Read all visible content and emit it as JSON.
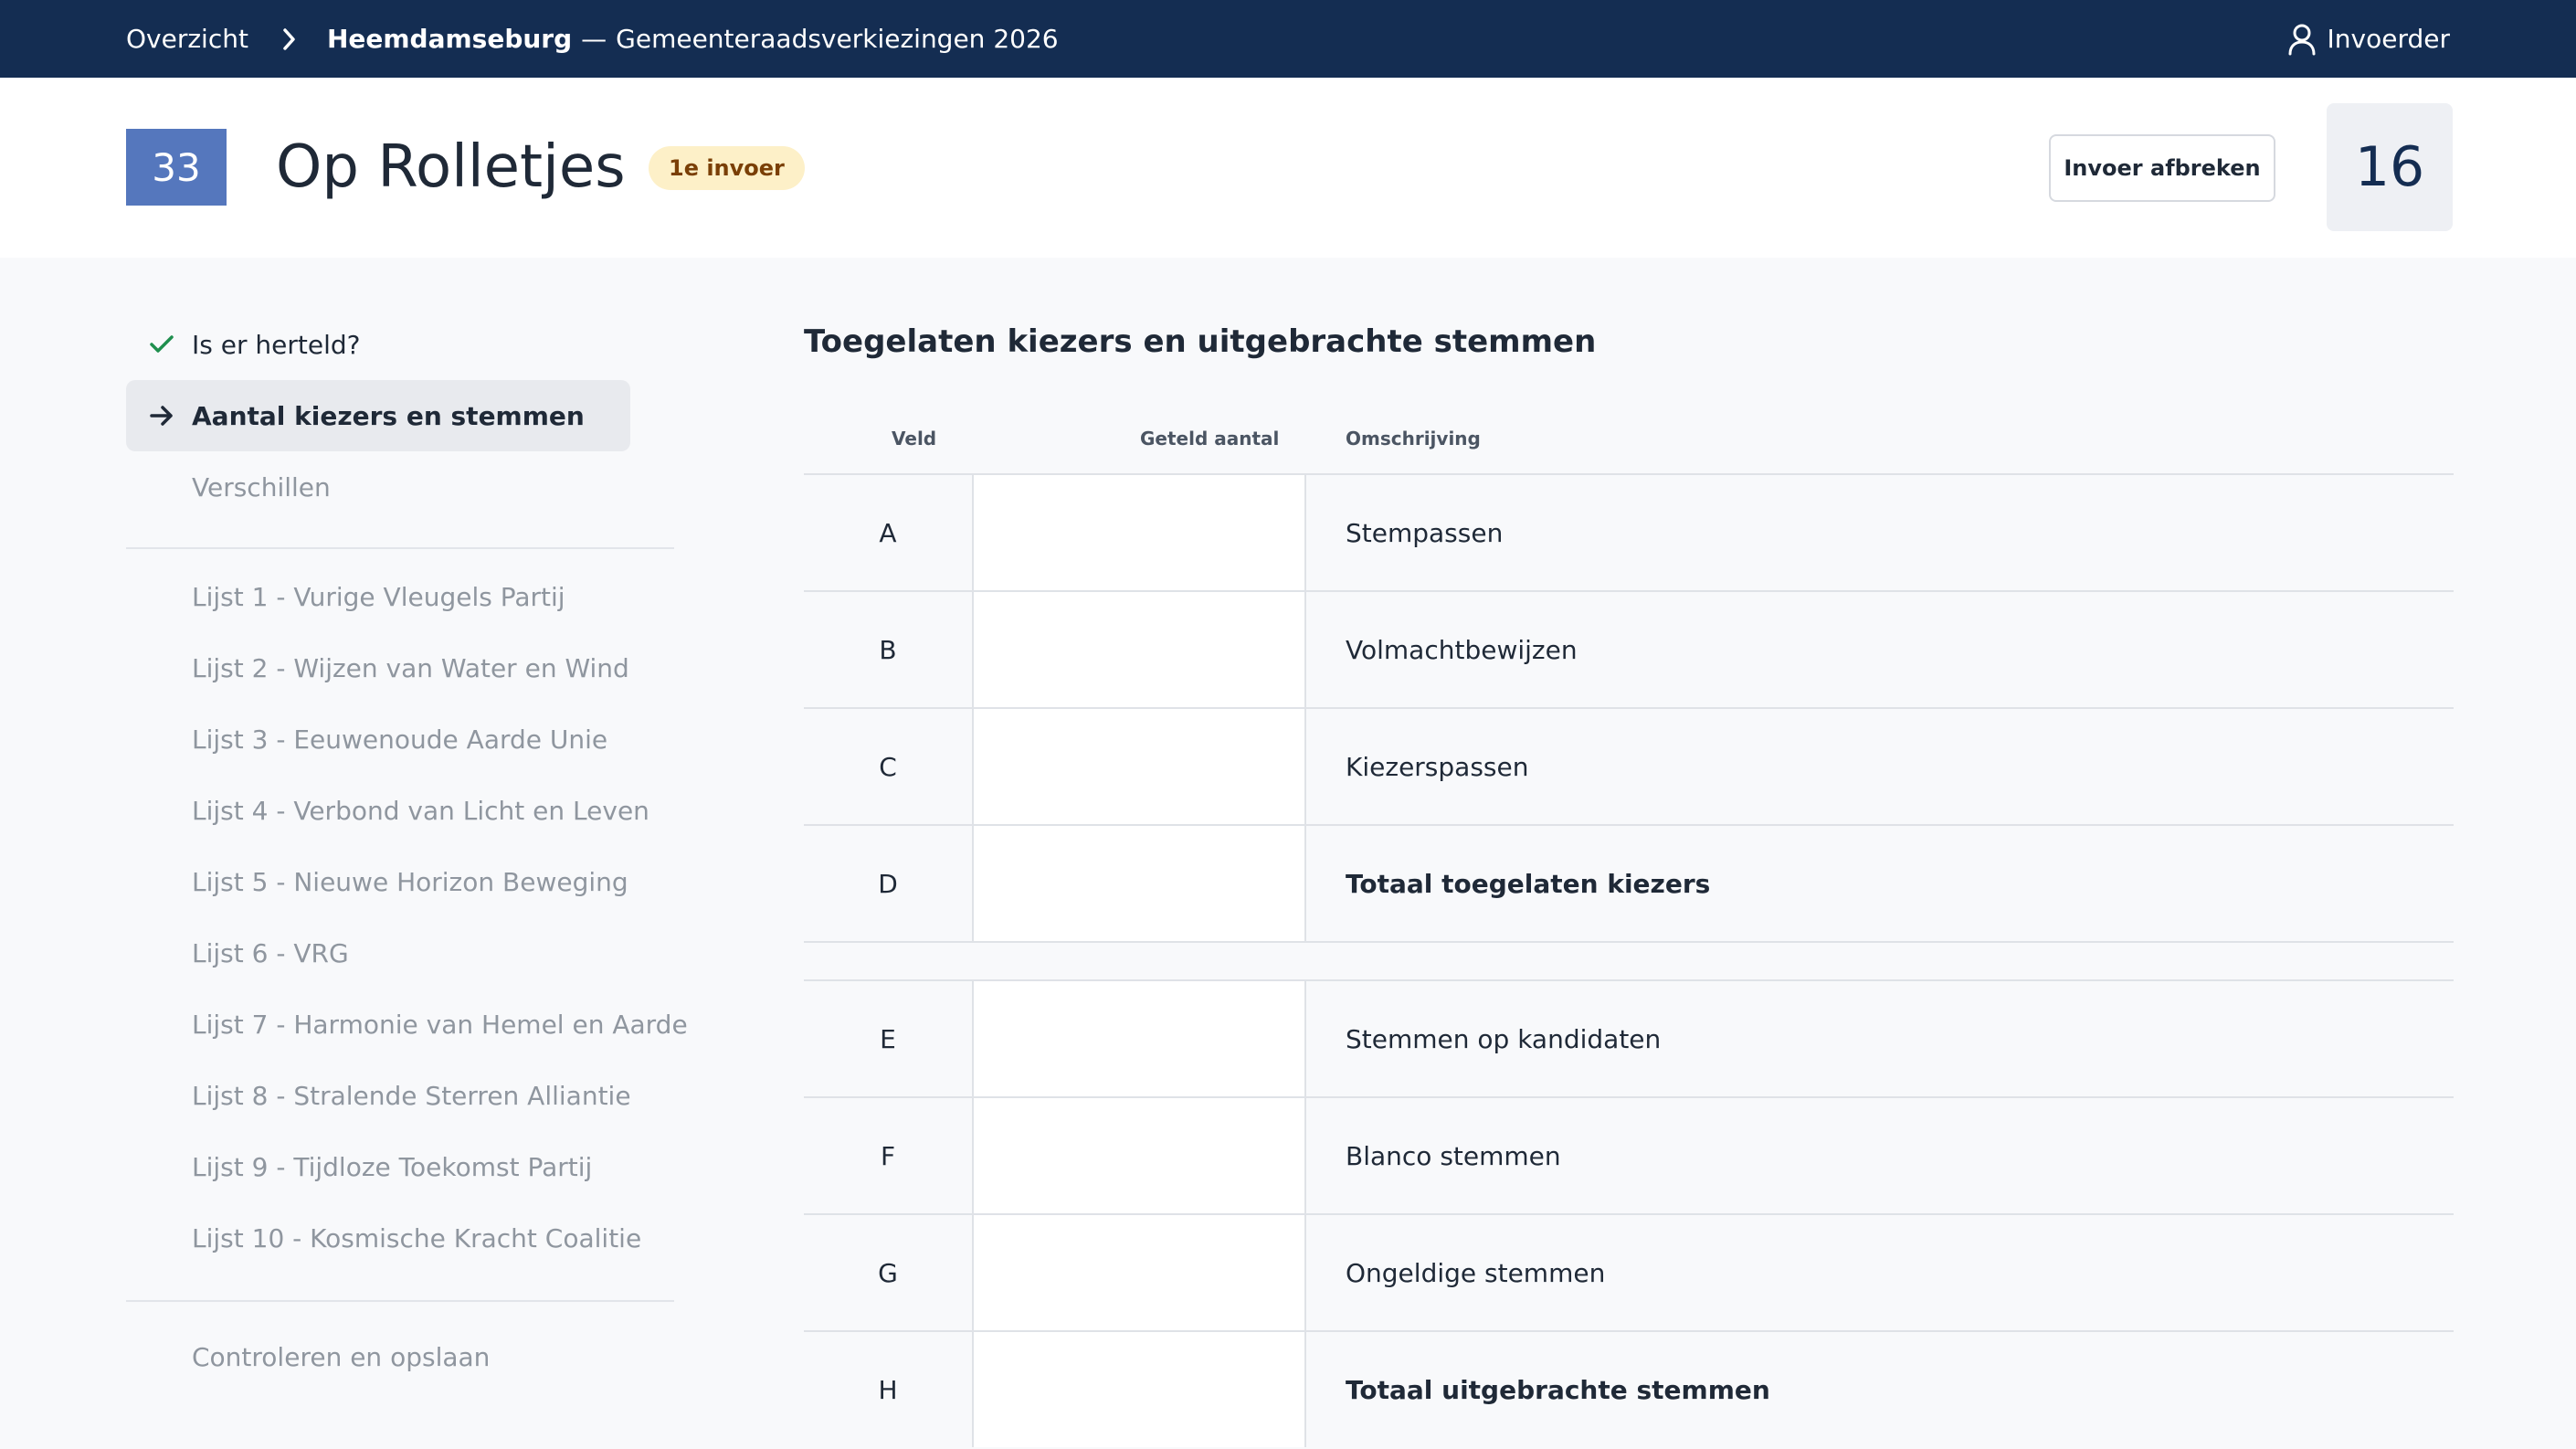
{
  "topbar": {
    "overview_link": "Overzicht",
    "municipality": "Heemdamseburg",
    "dash": "—",
    "election": "Gemeenteraadsverkiezingen 2026",
    "user_role": "Invoerder"
  },
  "header": {
    "station_number": "33",
    "station_name": "Op Rolletjes",
    "entry_badge": "1e invoer",
    "abort_label": "Invoer afbreken",
    "progress_number": "16"
  },
  "sidebar": {
    "top_items": [
      {
        "label": "Is er herteld?",
        "state": "done",
        "icon": "check-icon"
      },
      {
        "label": "Aantal kiezers en stemmen",
        "state": "active",
        "icon": "arrow-right-icon"
      },
      {
        "label": "Verschillen",
        "state": "disabled"
      }
    ],
    "lists": [
      {
        "label": "Lijst 1 - Vurige Vleugels Partij"
      },
      {
        "label": "Lijst 2 - Wijzen van Water en Wind"
      },
      {
        "label": "Lijst 3 - Eeuwenoude Aarde Unie"
      },
      {
        "label": "Lijst 4 - Verbond van Licht en Leven"
      },
      {
        "label": "Lijst 5 - Nieuwe Horizon Beweging"
      },
      {
        "label": "Lijst 6 - VRG"
      },
      {
        "label": "Lijst 7 - Harmonie van Hemel en Aarde"
      },
      {
        "label": "Lijst 8 - Stralende Sterren Alliantie"
      },
      {
        "label": "Lijst 9 - Tijdloze Toekomst Partij"
      },
      {
        "label": "Lijst 10 - Kosmische Kracht Coalitie"
      }
    ],
    "final_item": {
      "label": "Controleren en opslaan"
    }
  },
  "main": {
    "title": "Toegelaten kiezers en uitgebrachte stemmen",
    "columns": {
      "field": "Veld",
      "counted": "Geteld aantal",
      "description": "Omschrijving"
    },
    "rows": [
      {
        "code": "A",
        "value": "",
        "description": "Stempassen",
        "total": false
      },
      {
        "code": "B",
        "value": "",
        "description": "Volmachtbewijzen",
        "total": false
      },
      {
        "code": "C",
        "value": "",
        "description": "Kiezerspassen",
        "total": false
      },
      {
        "code": "D",
        "value": "",
        "description": "Totaal toegelaten kiezers",
        "total": true
      },
      {
        "code": "E",
        "value": "",
        "description": "Stemmen op kandidaten",
        "total": false
      },
      {
        "code": "F",
        "value": "",
        "description": "Blanco stemmen",
        "total": false
      },
      {
        "code": "G",
        "value": "",
        "description": "Ongeldige stemmen",
        "total": false
      },
      {
        "code": "H",
        "value": "",
        "description": "Totaal uitgebrachte stemmen",
        "total": true
      }
    ]
  },
  "colors": {
    "topbar": "#142d52",
    "station_badge": "#5577bd",
    "entry_badge_bg": "#fdf0c8",
    "entry_badge_text": "#7a3f06",
    "check": "#1f8f4e"
  }
}
